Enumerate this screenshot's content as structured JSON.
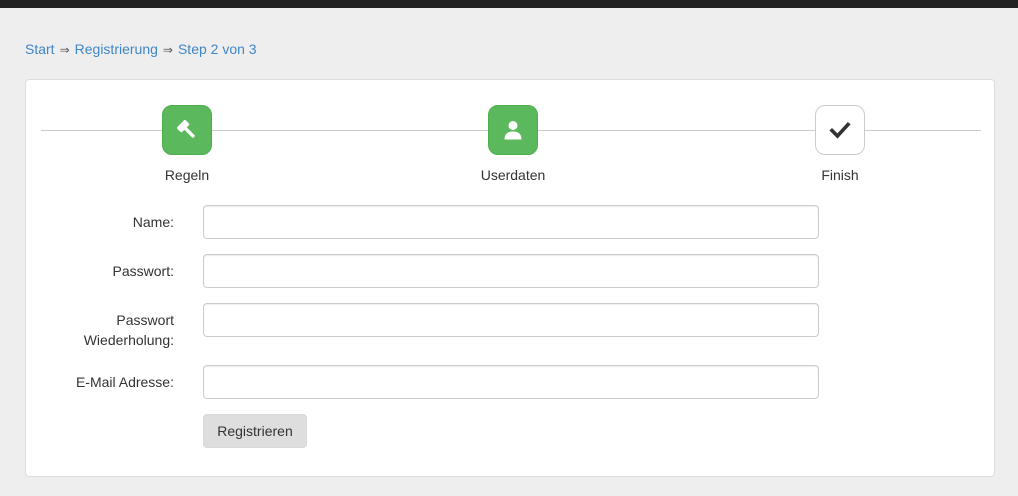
{
  "breadcrumb": {
    "items": [
      "Start",
      "Registrierung",
      "Step 2 von 3"
    ],
    "separator": "⇒"
  },
  "wizard": {
    "steps": [
      {
        "label": "Regeln",
        "icon": "gavel-icon",
        "state": "completed",
        "color": "#5cb85c"
      },
      {
        "label": "Userdaten",
        "icon": "user-icon",
        "state": "active",
        "color": "#5cb85c"
      },
      {
        "label": "Finish",
        "icon": "check-icon",
        "state": "inactive",
        "color": "#ffffff"
      }
    ]
  },
  "form": {
    "fields": [
      {
        "label": "Name:",
        "value": "",
        "type": "text"
      },
      {
        "label": "Passwort:",
        "value": "",
        "type": "password"
      },
      {
        "label_line1": "Passwort",
        "label_line2": "Wiederholung:",
        "value": "",
        "type": "password"
      },
      {
        "label": "E-Mail Adresse:",
        "value": "",
        "type": "email"
      }
    ],
    "submit_label": "Registrieren"
  },
  "colors": {
    "link": "#3f86c9",
    "step_active": "#5cb85c",
    "background": "#eeeeee"
  }
}
